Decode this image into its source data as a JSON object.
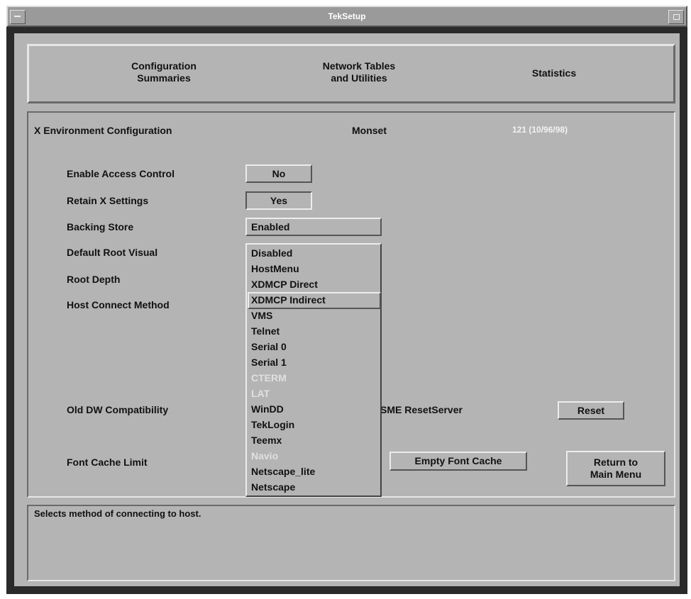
{
  "window": {
    "title": "TekSetup"
  },
  "tabs": [
    {
      "label": "Configuration\nSummaries"
    },
    {
      "label": "Network Tables\nand Utilities"
    },
    {
      "label": "Statistics"
    }
  ],
  "header": {
    "section": "X Environment Configuration",
    "monitor": "Monset",
    "ip": "121 (10/96/98)"
  },
  "settings": {
    "enable_access_control": {
      "label": "Enable Access Control",
      "value": "No"
    },
    "retain_x_settings": {
      "label": "Retain X Settings",
      "value": "Yes"
    },
    "backing_store": {
      "label": "Backing Store",
      "value": "Enabled"
    },
    "default_root_visual": {
      "label": "Default Root Visual"
    },
    "root_depth": {
      "label": "Root Depth"
    },
    "host_connect_method": {
      "label": "Host Connect Method"
    },
    "old_dw_compat": {
      "label": "Old DW Compatibility"
    },
    "font_cache_limit": {
      "label": "Font Cache Limit"
    }
  },
  "dropdown": {
    "items": [
      {
        "label": "Disabled",
        "enabled": true
      },
      {
        "label": "HostMenu",
        "enabled": true
      },
      {
        "label": "XDMCP Direct",
        "enabled": true
      },
      {
        "label": "XDMCP Indirect",
        "enabled": true,
        "selected": true
      },
      {
        "label": "VMS",
        "enabled": true
      },
      {
        "label": "Telnet",
        "enabled": true
      },
      {
        "label": "Serial 0",
        "enabled": true
      },
      {
        "label": "Serial 1",
        "enabled": true
      },
      {
        "label": "CTERM",
        "enabled": false
      },
      {
        "label": "LAT",
        "enabled": false
      },
      {
        "label": "WinDD",
        "enabled": true
      },
      {
        "label": "TekLogin",
        "enabled": true
      },
      {
        "label": "Teemx",
        "enabled": true
      },
      {
        "label": "Navio",
        "enabled": false
      },
      {
        "label": "Netscape_lite",
        "enabled": true
      },
      {
        "label": "Netscape",
        "enabled": true
      }
    ]
  },
  "actions": {
    "sme_reset_label": "SME ResetServer",
    "reset": "Reset",
    "empty_font_cache": "Empty Font Cache",
    "return_main": "Return to\nMain Menu"
  },
  "status": {
    "help_text": "Selects method of connecting to host."
  }
}
